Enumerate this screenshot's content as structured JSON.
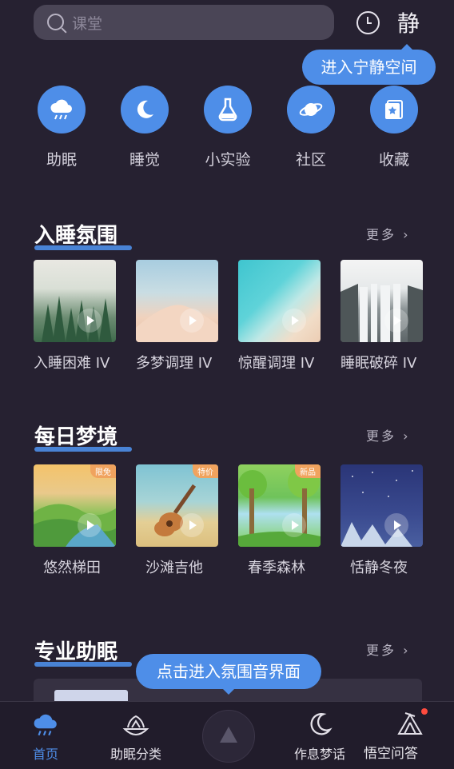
{
  "search": {
    "placeholder": "课堂"
  },
  "header": {
    "history_icon": "clock-icon",
    "quiet_label": "静"
  },
  "tips": {
    "quiet_space": "进入宁静空间",
    "ambience": "点击进入氛围音界面"
  },
  "categories": [
    {
      "label": "助眠",
      "icon": "rain-cloud-icon"
    },
    {
      "label": "睡觉",
      "icon": "moon-icon"
    },
    {
      "label": "小实验",
      "icon": "flask-icon"
    },
    {
      "label": "社区",
      "icon": "planet-icon"
    },
    {
      "label": "收藏",
      "icon": "star-bookmark-icon"
    }
  ],
  "sections": [
    {
      "title": "入睡氛围",
      "more": "更多 ›",
      "items": [
        {
          "label": "入睡困难 IV"
        },
        {
          "label": "多梦调理 IV"
        },
        {
          "label": "惊醒调理 IV"
        },
        {
          "label": "睡眠破碎 IV"
        }
      ]
    },
    {
      "title": "每日梦境",
      "more": "更多 ›",
      "items": [
        {
          "label": "悠然梯田",
          "badge": "限免"
        },
        {
          "label": "沙滩吉他",
          "badge": "特价"
        },
        {
          "label": "春季森林",
          "badge": "新品"
        },
        {
          "label": "恬静冬夜",
          "badge": ""
        }
      ]
    },
    {
      "title": "专业助眠",
      "more": "更多 ›"
    }
  ],
  "tabs": [
    {
      "label": "首页",
      "icon": "rain-cloud-icon",
      "active": true
    },
    {
      "label": "助眠分类",
      "icon": "lotus-icon"
    },
    {
      "label": "",
      "icon": "triangle-play-icon"
    },
    {
      "label": "作息梦话",
      "icon": "moon-icon"
    },
    {
      "label": "",
      "icon": "tent-icon"
    }
  ],
  "watermark": "悟空问答",
  "colors": {
    "accent": "#4e8ee8",
    "background": "#262131"
  }
}
